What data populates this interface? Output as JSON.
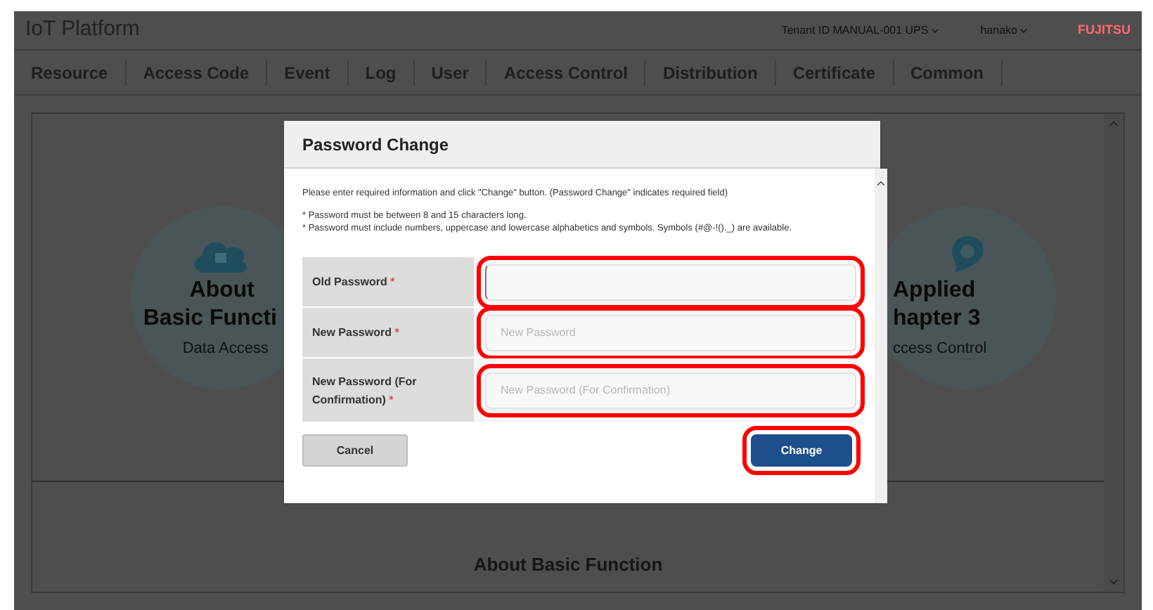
{
  "header": {
    "title": "IoT Platform",
    "tenant": "Tenant ID MANUAL-001 UPS",
    "user": "hanako",
    "logo": "FUJITSU"
  },
  "nav": [
    {
      "label": "Resource"
    },
    {
      "label": "Access Code"
    },
    {
      "label": "Event"
    },
    {
      "label": "Log"
    },
    {
      "label": "User"
    },
    {
      "label": "Access Control"
    },
    {
      "label": "Distribution"
    },
    {
      "label": "Certificate"
    },
    {
      "label": "Common"
    }
  ],
  "cards": [
    {
      "kind": "cloud",
      "title": [
        "About",
        "Basic Functi"
      ],
      "subtitle": "Data Access"
    },
    {
      "kind": "pin",
      "title": [
        "Applied",
        "hapter 3"
      ],
      "subtitle": "ccess Control"
    }
  ],
  "section_heading": "About Basic Function",
  "dialog": {
    "title": "Password Change",
    "intro": "Please enter required information and click \"Change\" button. (Password Change\" indicates required field)",
    "notes": [
      "* Password must be between 8 and 15 characters long.",
      "* Password must include numbers, uppercase and lowercase alphabetics and symbols. Symbols (#@-!()._) are available."
    ],
    "fields": [
      {
        "label": "Old Password",
        "required_mark": "*",
        "focused": true,
        "highlighted": true
      },
      {
        "label": "New Password",
        "required_mark": "*",
        "placeholder": "New Password",
        "focused": false,
        "highlighted": true
      },
      {
        "label": "New Password (For Confirmation)",
        "required_mark": "*",
        "placeholder": "New Password (For Confirmation)",
        "focused": false,
        "highlighted": true
      }
    ],
    "cancel": {
      "label": "Cancel",
      "highlighted": false
    },
    "change": {
      "label": "Change",
      "highlighted": true
    }
  }
}
